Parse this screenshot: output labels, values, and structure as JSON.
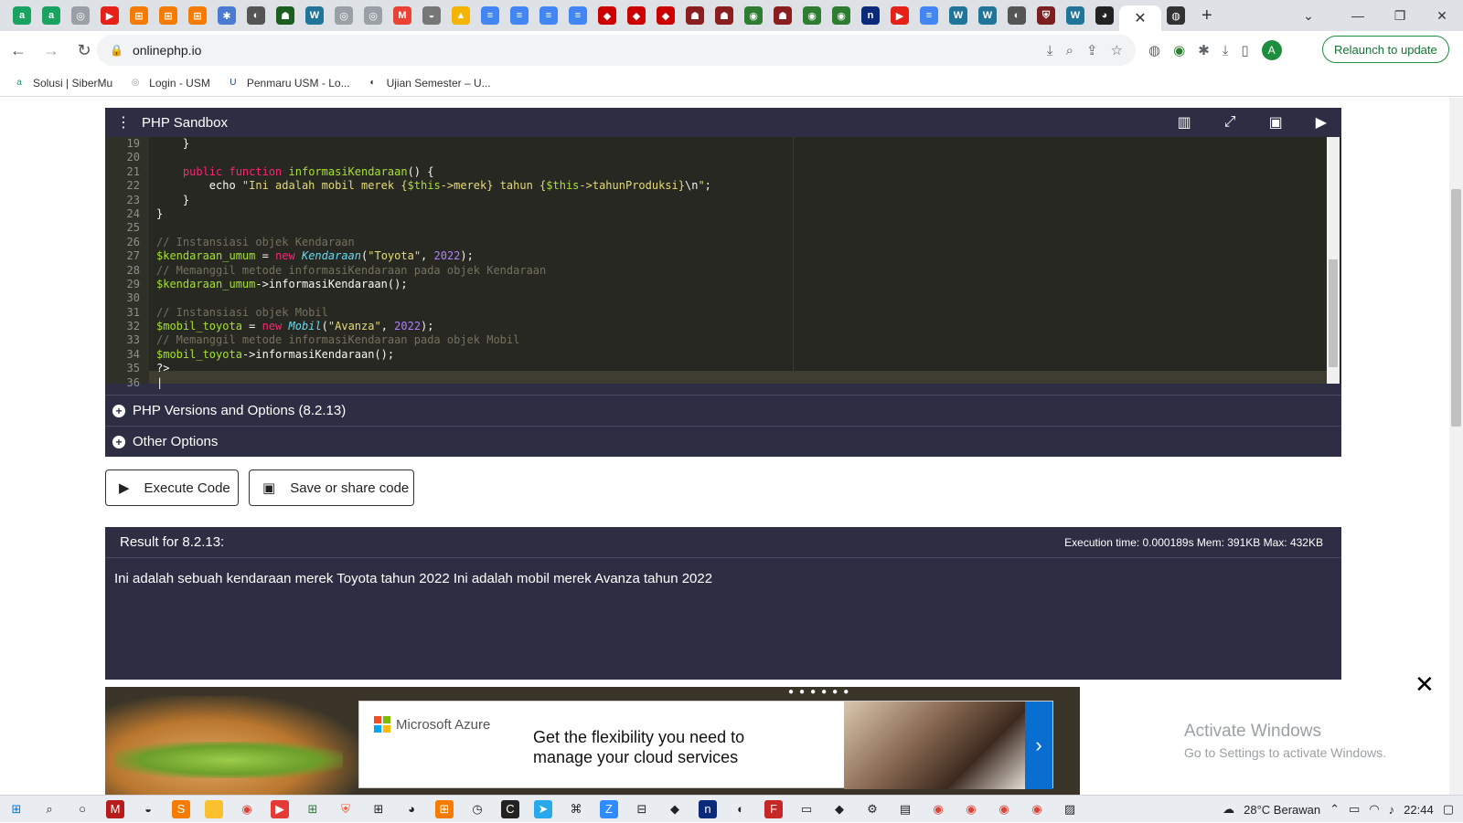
{
  "browser": {
    "url": "onlinephp.io",
    "relaunch_label": "Relaunch to update",
    "avatar_letter": "A",
    "bookmarks": [
      "Solusi | SiberMu",
      "Login - USM",
      "Penmaru USM - Lo...",
      "Ujian Semester – U..."
    ],
    "tab_close": "✕",
    "tab_new": "+"
  },
  "sandbox": {
    "title": "PHP Sandbox",
    "gutter_lines": [
      "19",
      "20",
      "21",
      "22",
      "23",
      "24",
      "25",
      "26",
      "27",
      "28",
      "29",
      "30",
      "31",
      "32",
      "33",
      "34",
      "35",
      "36"
    ],
    "versions_label": "PHP Versions and Options (8.2.13)",
    "other_label": "Other Options"
  },
  "buttons": {
    "execute_label": "Execute Code",
    "save_share_label": "Save or share code"
  },
  "result": {
    "title": "Result for 8.2.13:",
    "exec_time": "Execution time: 0.000189s Mem: 391KB Max: 432KB",
    "output": "Ini adalah sebuah kendaraan merek Toyota tahun 2022 Ini adalah mobil merek Avanza tahun 2022"
  },
  "ad": {
    "brand": "Microsoft Azure",
    "headline": "Get the flexibility you need to manage your cloud services"
  },
  "windows_notice": {
    "line1": "Activate Windows",
    "line2": "Go to Settings to activate Windows."
  },
  "taskbar": {
    "weather": "28°C  Berawan",
    "time": "22:44"
  }
}
